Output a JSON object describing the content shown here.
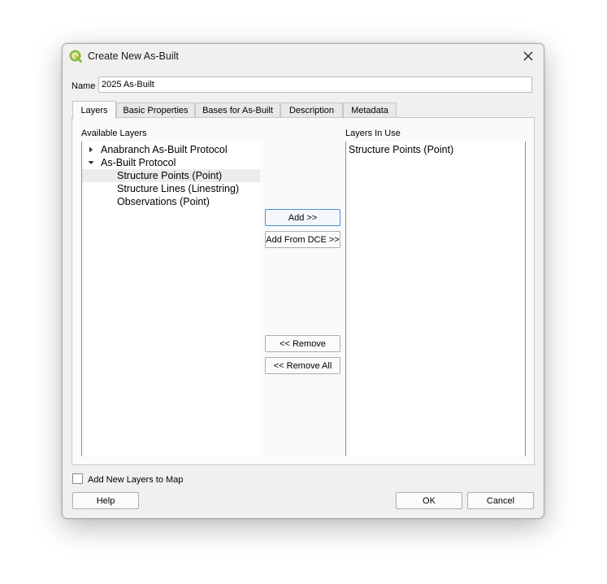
{
  "window": {
    "title": "Create New As-Built",
    "close_icon": "close-icon",
    "app_icon": "qgis-icon"
  },
  "name": {
    "label": "Name",
    "value": "2025 As-Built"
  },
  "tabs": [
    {
      "label": "Layers",
      "active": true
    },
    {
      "label": "Basic Properties",
      "active": false
    },
    {
      "label": "Bases for As-Built",
      "active": false
    },
    {
      "label": "Description",
      "active": false
    },
    {
      "label": "Metadata",
      "active": false
    }
  ],
  "available": {
    "label": "Available Layers",
    "items": [
      {
        "label": "Anabranch As-Built Protocol",
        "type": "group",
        "expanded": false
      },
      {
        "label": "As-Built Protocol",
        "type": "group",
        "expanded": true
      },
      {
        "label": "Structure Points (Point)",
        "type": "layer",
        "selected": true
      },
      {
        "label": "Structure Lines (Linestring)",
        "type": "layer",
        "selected": false
      },
      {
        "label": "Observations (Point)",
        "type": "layer",
        "selected": false
      }
    ]
  },
  "in_use": {
    "label": "Layers In Use",
    "items": [
      "Structure Points (Point)"
    ]
  },
  "buttons": {
    "add": "Add >>",
    "add_from_dce": "Add From DCE >>",
    "remove": "<< Remove",
    "remove_all": "<< Remove All",
    "help": "Help",
    "ok": "OK",
    "cancel": "Cancel"
  },
  "checkbox": {
    "label": "Add New Layers to Map",
    "checked": false
  },
  "colors": {
    "accent": "#4a90d9",
    "qgis_green": "#8bbf3f"
  }
}
